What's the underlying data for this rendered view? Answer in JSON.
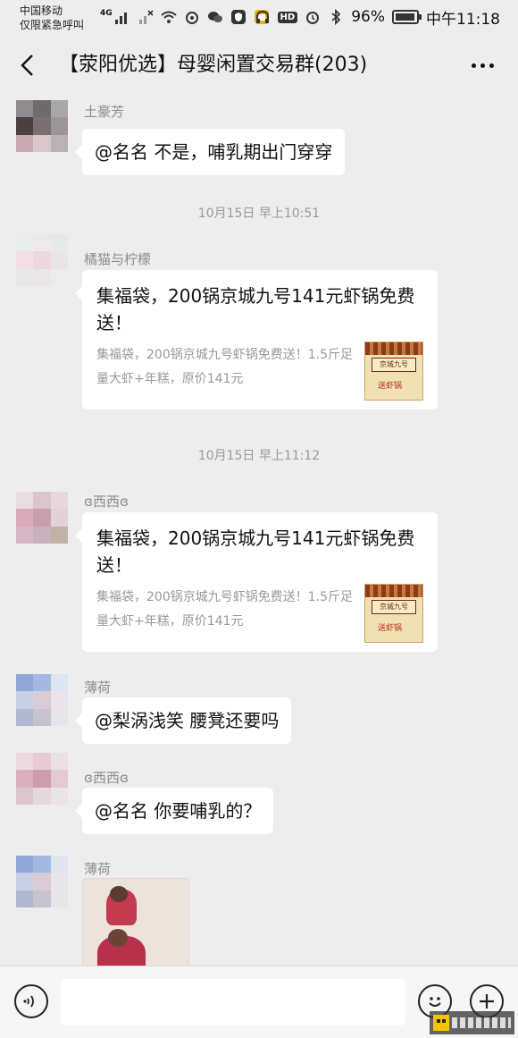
{
  "status_bar": {
    "carrier_line1": "中国移动",
    "carrier_line2": "仅限紧急呼叫",
    "network": "4G",
    "battery_level": 0.96,
    "battery_text": "96%",
    "time": "中午11:18",
    "hd": "HD"
  },
  "header": {
    "title": "【荥阳优选】母婴闲置交易群(203)"
  },
  "messages": [
    {
      "type": "text",
      "sender": "土豪芳",
      "text": "@名名  不是，哺乳期出门穿穿"
    },
    {
      "type": "time",
      "text": "10月15日 早上10:51"
    },
    {
      "type": "card",
      "sender": "橘猫与柠檬",
      "title": "集福袋，200锅京城九号141元虾锅免费送！",
      "desc": "集福袋，200锅京城九号虾锅免费送！1.5斤足量大虾+年糕，原价141元",
      "thumb_sign": "京城九号",
      "thumb_text": "送虾锅"
    },
    {
      "type": "time",
      "text": "10月15日 早上11:12"
    },
    {
      "type": "card",
      "sender": "ɞ西西ɞ",
      "title": "集福袋，200锅京城九号141元虾锅免费送！",
      "desc": "集福袋，200锅京城九号虾锅免费送！1.5斤足量大虾+年糕，原价141元",
      "thumb_sign": "京城九号",
      "thumb_text": "送虾锅"
    },
    {
      "type": "text",
      "sender": "薄荷",
      "text": "@梨涡浅笑  腰凳还要吗"
    },
    {
      "type": "text",
      "sender": "ɞ西西ɞ",
      "text": "@名名  你要哺乳的？"
    },
    {
      "type": "image",
      "sender": "薄荷"
    }
  ],
  "input_bar": {
    "placeholder": ""
  },
  "colors": {
    "background": "#ededed",
    "bubble": "#ffffff",
    "meta_text": "#999999"
  },
  "icons": [
    "back-arrow-icon",
    "more-icon",
    "voice-icon",
    "emoji-icon",
    "plus-icon"
  ]
}
